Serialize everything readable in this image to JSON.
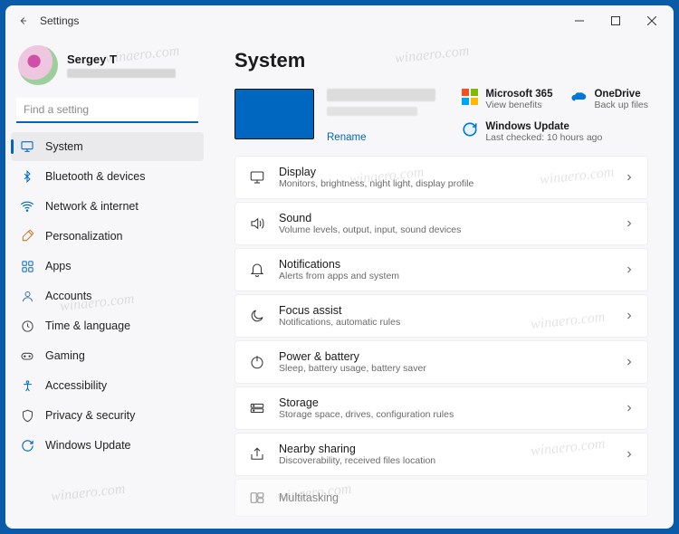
{
  "window": {
    "title": "Settings"
  },
  "user": {
    "name": "Sergey T"
  },
  "search": {
    "placeholder": "Find a setting"
  },
  "sidebar": {
    "items": [
      {
        "label": "System"
      },
      {
        "label": "Bluetooth & devices"
      },
      {
        "label": "Network & internet"
      },
      {
        "label": "Personalization"
      },
      {
        "label": "Apps"
      },
      {
        "label": "Accounts"
      },
      {
        "label": "Time & language"
      },
      {
        "label": "Gaming"
      },
      {
        "label": "Accessibility"
      },
      {
        "label": "Privacy & security"
      },
      {
        "label": "Windows Update"
      }
    ]
  },
  "main": {
    "heading": "System",
    "rename": "Rename",
    "promos": {
      "m365": {
        "title": "Microsoft 365",
        "sub": "View benefits"
      },
      "onedrive": {
        "title": "OneDrive",
        "sub": "Back up files"
      },
      "wu": {
        "title": "Windows Update",
        "sub": "Last checked: 10 hours ago"
      }
    },
    "cards": [
      {
        "title": "Display",
        "sub": "Monitors, brightness, night light, display profile"
      },
      {
        "title": "Sound",
        "sub": "Volume levels, output, input, sound devices"
      },
      {
        "title": "Notifications",
        "sub": "Alerts from apps and system"
      },
      {
        "title": "Focus assist",
        "sub": "Notifications, automatic rules"
      },
      {
        "title": "Power & battery",
        "sub": "Sleep, battery usage, battery saver"
      },
      {
        "title": "Storage",
        "sub": "Storage space, drives, configuration rules"
      },
      {
        "title": "Nearby sharing",
        "sub": "Discoverability, received files location"
      },
      {
        "title": "Multitasking",
        "sub": ""
      }
    ]
  },
  "watermark": "winaero.com"
}
